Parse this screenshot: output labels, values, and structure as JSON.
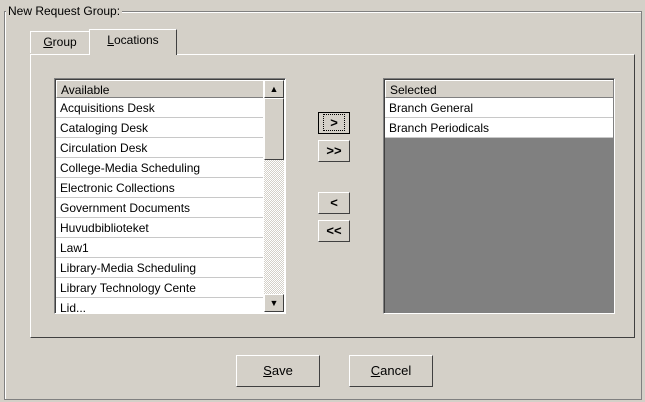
{
  "group": {
    "title": "New Request Group:"
  },
  "tabs": [
    {
      "label": "Group",
      "accel": "G",
      "rest": "roup"
    },
    {
      "label": "Locations",
      "accel": "L",
      "rest": "ocations"
    }
  ],
  "available": {
    "header": "Available",
    "items": [
      "Acquisitions Desk",
      "Cataloging Desk",
      "Circulation Desk",
      "College-Media Scheduling",
      "Electronic Collections",
      "Government Documents",
      "Huvudbiblioteket",
      "Law1",
      "Library-Media Scheduling",
      "Library Technology Cente",
      "Lid..."
    ]
  },
  "selected": {
    "header": "Selected",
    "items": [
      "Branch General",
      "Branch Periodicals"
    ]
  },
  "buttons": {
    "add": ">",
    "add_all": ">>",
    "remove": "<",
    "remove_all": "<<",
    "save": {
      "accel": "S",
      "rest": "ave"
    },
    "cancel": {
      "accel": "C",
      "rest": "ancel"
    }
  },
  "icons": {
    "scroll_up": "triangle-up",
    "scroll_down": "triangle-down"
  }
}
